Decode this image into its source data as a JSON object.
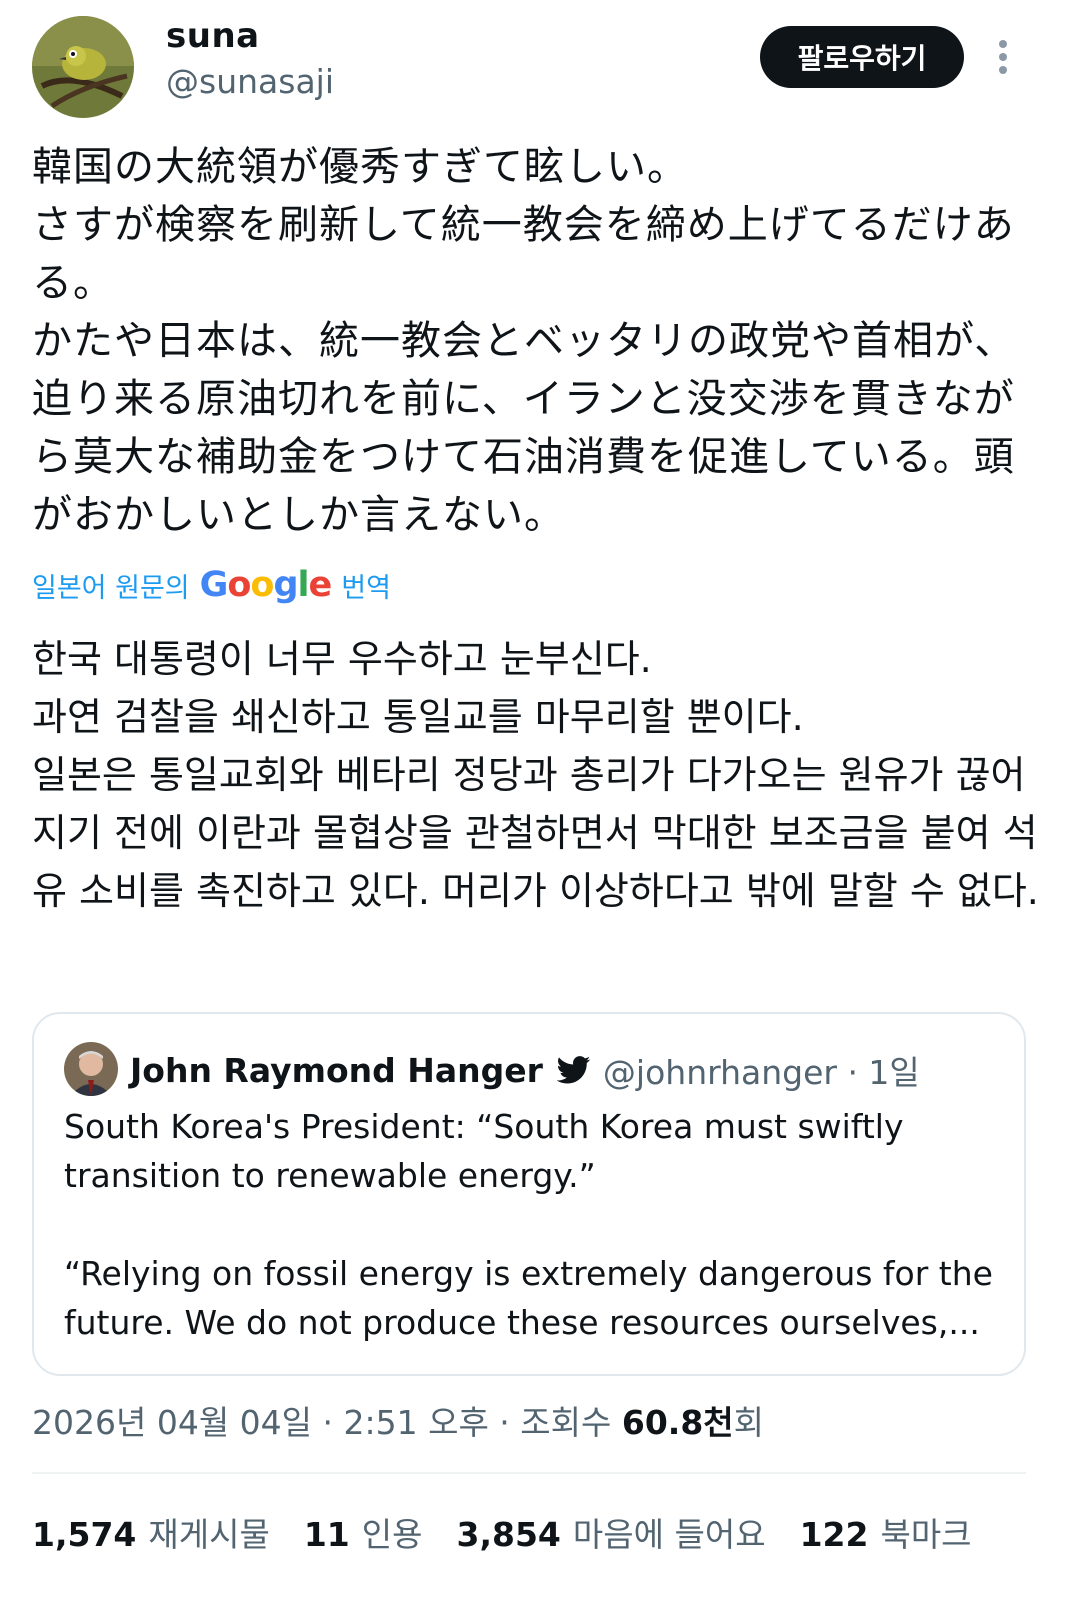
{
  "user": {
    "name": "suna",
    "handle": "@sunasaji",
    "follow_label": "팔로우하기"
  },
  "tweet": {
    "text_ja": "韓国の大統領が優秀すぎて眩しい。\nさすが検察を刷新して統一教会を締め上げてるだけある。\nかたや日本は、統一教会とベッタリの政党や首相が、迫り来る原油切れを前に、イランと没交渉を貫きながら莫大な補助金をつけて石油消費を促進している。頭がおかしいとしか言えない。",
    "translate_prefix": "일본어 원문의",
    "translate_brand": "Google",
    "translate_suffix": "번역",
    "text_ko": "한국 대통령이 너무 우수하고 눈부신다.\n과연 검찰을 쇄신하고 통일교를 마무리할 뿐이다.\n일본은 통일교회와 베타리 정당과 총리가 다가오는 원유가 끊어지기 전에 이란과 몰협상을 관철하면서 막대한 보조금을 붙여 석유 소비를 촉진하고 있다. 머리가 이상하다고 밖에 말할 수 없다."
  },
  "quote": {
    "name": "John Raymond Hanger",
    "handle_time": "@johnrhanger · 1일",
    "text": "South Korea's President: “South Korea must swiftly transition to renewable energy.”\n\n“Relying on fossil energy is extremely dangerous for the future. We do not produce these resources ourselves,..."
  },
  "meta": {
    "datetime": "2026년 04월 04일 · 2:51 오후 · 조회수 ",
    "views": "60.8천",
    "views_suffix": "회"
  },
  "stats": [
    {
      "count": "1,574",
      "label": "재게시물"
    },
    {
      "count": "11",
      "label": "인용"
    },
    {
      "count": "3,854",
      "label": "마음에 들어요"
    },
    {
      "count": "122",
      "label": "북마크"
    }
  ],
  "colors": {
    "link": "#1d9bf0",
    "muted": "#536471",
    "text": "#0f1419"
  },
  "icons": {
    "more": "more-vertical-icon",
    "verified": "twitter-bird-icon"
  }
}
